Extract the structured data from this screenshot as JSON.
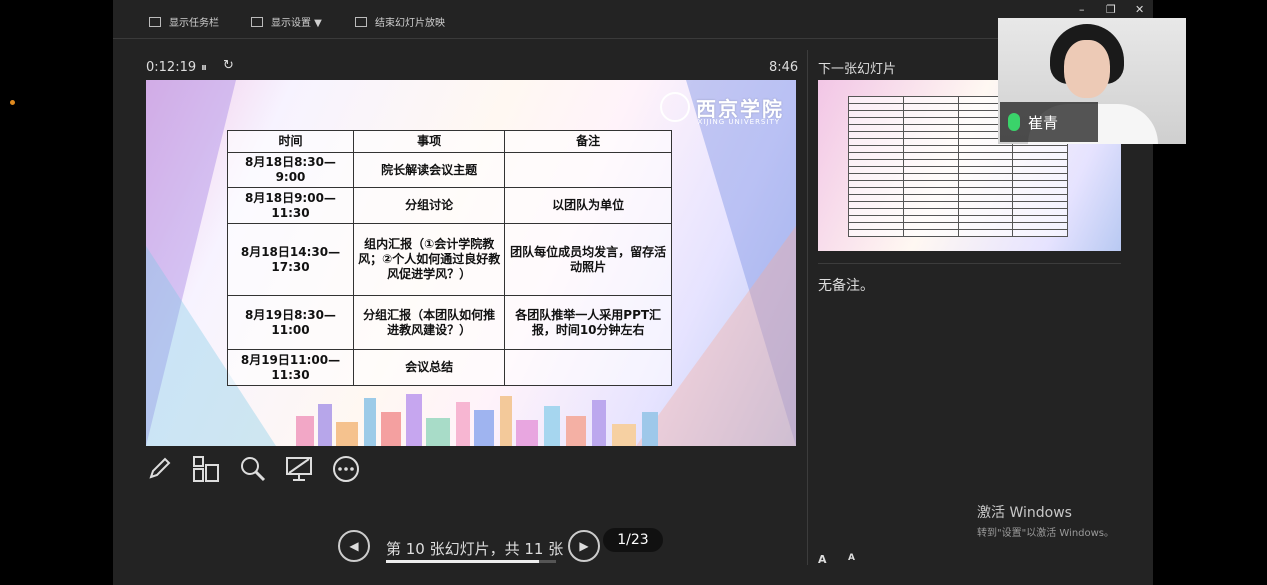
{
  "toolbar": {
    "show_taskbar": "显示任务栏",
    "display_settings": "显示设置 ▼",
    "end_slideshow": "结束幻灯片放映"
  },
  "window_controls": {
    "minimize": "–",
    "restore": "❐",
    "close": "✕"
  },
  "presenter": {
    "elapsed": "0:12:19",
    "clock": "8:46",
    "pause_icon": "⏸",
    "restart_icon": "↻"
  },
  "slide": {
    "logo_text": "西京学院",
    "logo_subtitle": "XIJING UNIVERSITY",
    "table": {
      "headers": [
        "时间",
        "事项",
        "备注"
      ],
      "rows": [
        [
          "8月18日8:30—9:00",
          "院长解读会议主题",
          ""
        ],
        [
          "8月18日9:00—11:30",
          "分组讨论",
          "以团队为单位"
        ],
        [
          "8月18日14:30—17:30",
          "组内汇报（①会计学院教风；②个人如何通过良好教风促进学风？）",
          "团队每位成员均发言，留存活动照片"
        ],
        [
          "8月19日8:30—11:00",
          "分组汇报（本团队如何推进教风建设？）",
          "各团队推举一人采用PPT汇报，时间10分钟左右"
        ],
        [
          "8月19日11:00—11:30",
          "会议总结",
          ""
        ]
      ]
    }
  },
  "tools": [
    "pen-icon",
    "slides-grid-icon",
    "zoom-icon",
    "screen-icon",
    "more-icon"
  ],
  "navigation": {
    "prev": "◀",
    "next": "▶",
    "slide_counter": "第 10 张幻灯片，共 11 张",
    "progress": 0.9,
    "page_badge": "1/23"
  },
  "next_slide": {
    "label": "下一张幻灯片"
  },
  "notes": {
    "text": "无备注。"
  },
  "font_controls": {
    "increase": "A",
    "decrease": "A"
  },
  "camera": {
    "name": "崔青",
    "mic_color": "#3ad36a"
  },
  "activation": {
    "title": "激活 Windows",
    "subtitle": "转到\"设置\"以激活 Windows。"
  },
  "colors": {
    "window_bg": "#232323",
    "accent_dot": "#e08a1f"
  }
}
